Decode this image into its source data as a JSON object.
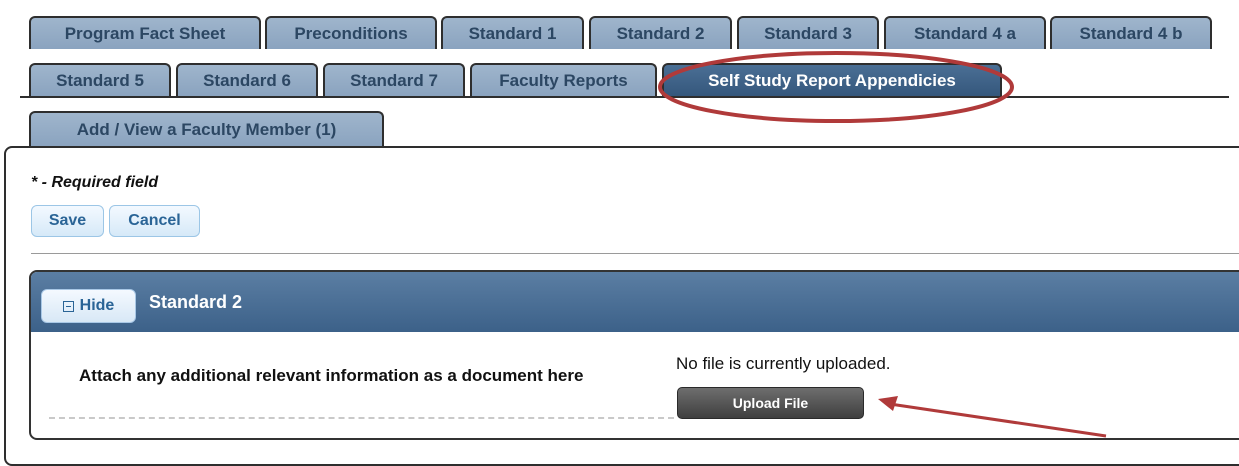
{
  "tabs": {
    "row1": [
      "Program Fact Sheet",
      "Preconditions",
      "Standard 1",
      "Standard 2",
      "Standard 3",
      "Standard 4 a",
      "Standard 4 b"
    ],
    "row2": [
      "Standard 5",
      "Standard 6",
      "Standard 7",
      "Faculty Reports",
      "Self Study Report Appendicies"
    ],
    "row3": [
      "Add / View a Faculty Member (1)"
    ],
    "active": "Self Study Report Appendicies"
  },
  "form": {
    "required_note": "* - Required field",
    "save_label": "Save",
    "cancel_label": "Cancel"
  },
  "section": {
    "hide_label": "Hide",
    "title": "Standard 2",
    "field_label": "Attach any additional relevant information as a document here",
    "file_status": "No file is currently uploaded.",
    "upload_label": "Upload File"
  },
  "colors": {
    "tab_inactive": "#9fb5cc",
    "tab_active": "#3f6288",
    "annotation_red": "#b03a3a"
  },
  "icons": [
    "minus-icon"
  ]
}
